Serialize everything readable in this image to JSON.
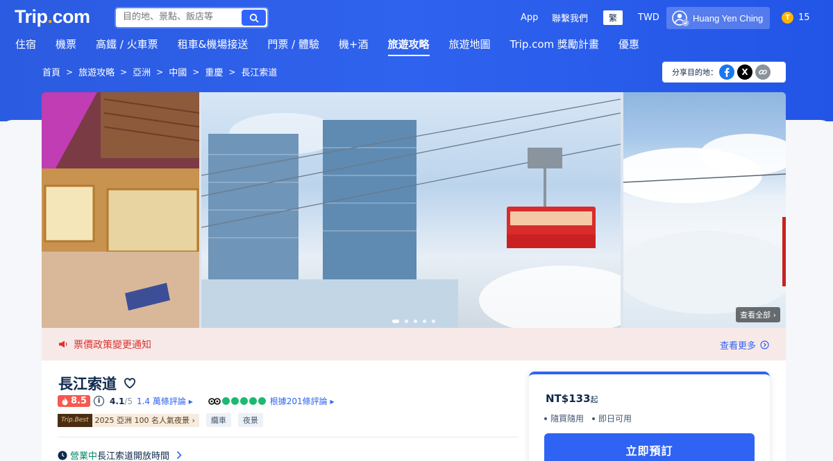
{
  "header": {
    "logo_main": "Trip",
    "logo_dot": ".",
    "logo_tail": "com",
    "search_placeholder": "目的地、景點、飯店等",
    "app": "App",
    "contact": "聯繫我們",
    "language": "繁",
    "currency": "TWD",
    "user_name": "Huang Yen Ching",
    "coins_icon": "T",
    "coins": "15"
  },
  "nav": {
    "items": [
      "住宿",
      "機票",
      "高鐵 / 火車票",
      "租車&機場接送",
      "門票 / 體驗",
      "機+酒",
      "旅遊攻略",
      "旅遊地圖",
      "Trip.com 獎勵計畫",
      "優惠"
    ],
    "active_index": 6
  },
  "breadcrumb": {
    "items": [
      "首頁",
      "旅遊攻略",
      "亞洲",
      "中國",
      "重慶",
      "長江索道"
    ],
    "separator": ">"
  },
  "share": {
    "label": "分享目的地：",
    "icons": [
      "facebook-icon",
      "x-icon",
      "link-icon"
    ],
    "x_glyph": "X"
  },
  "gallery": {
    "view_all": "查看全部"
  },
  "notice": {
    "text": "票價政策變更通知",
    "see_more": "查看更多"
  },
  "attraction": {
    "name": "長江索道",
    "score": "8.5",
    "info_glyph": "i",
    "rating": "4.1",
    "rating_out_of": "/5",
    "review_count": "1.4 萬條評論",
    "tripadvisor_reviews": "根據201條評論",
    "badge_logo": "Trip.Best",
    "badge_text": "2025 亞洲 100 名人氣夜景",
    "tags": [
      "纜車",
      "夜景"
    ],
    "open_status": "營業中",
    "open_text": "長江索道開放時間"
  },
  "booking": {
    "price": "NT$133",
    "price_suffix": "起",
    "perks": [
      "隨買隨用",
      "即日可用"
    ],
    "button": "立即預訂"
  },
  "colors": {
    "brand_blue": "#2f63f3",
    "notice_red": "#d9352f",
    "score_red": "#f5594f",
    "open_green": "#0a8a6a",
    "tripadvisor_green": "#1db970"
  }
}
